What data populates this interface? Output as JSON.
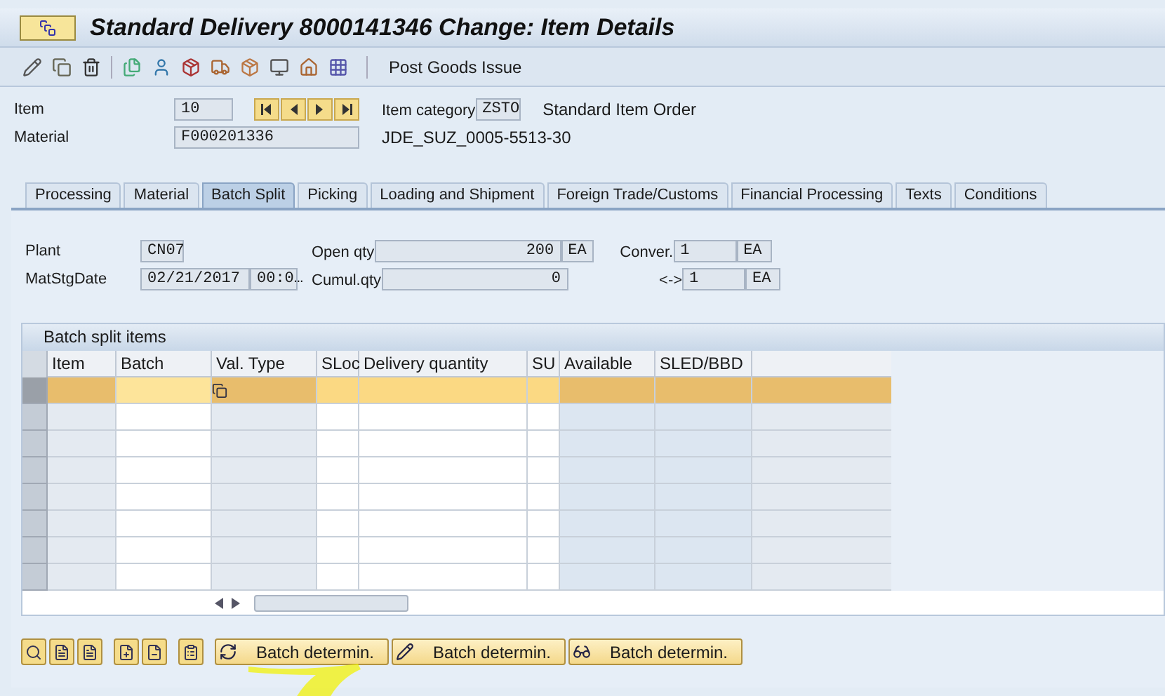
{
  "window": {
    "title": "Standard Delivery 8000141346 Change: Item Details"
  },
  "toolbar": {
    "action": "Post Goods Issue"
  },
  "header": {
    "item_label": "Item",
    "item": "10",
    "category_label": "Item category",
    "category": "ZSTO",
    "category_text": "Standard Item Order",
    "material_label": "Material",
    "material": "F000201336",
    "material_text": "JDE_SUZ_0005-5513-30"
  },
  "tabs": [
    {
      "label": "Processing",
      "selected": false
    },
    {
      "label": "Material",
      "selected": false
    },
    {
      "label": "Batch Split",
      "selected": true
    },
    {
      "label": "Picking",
      "selected": false
    },
    {
      "label": "Loading and Shipment",
      "selected": false
    },
    {
      "label": "Foreign Trade/Customs",
      "selected": false
    },
    {
      "label": "Financial Processing",
      "selected": false
    },
    {
      "label": "Texts",
      "selected": false
    },
    {
      "label": "Conditions",
      "selected": false
    }
  ],
  "fields": {
    "plant_label": "Plant",
    "plant": "CN07",
    "date_label": "MatStgDate",
    "date": "02/21/2017",
    "time": "00:0…",
    "open_label": "Open qty",
    "open": "200",
    "open_unit": "EA",
    "cumul_label": "Cumul.qty",
    "cumul": "0",
    "conv_label": "Conver.",
    "conv": "1",
    "conv_unit": "EA",
    "arrow_label": "<->",
    "conv2": "1",
    "conv2_unit": "EA"
  },
  "table": {
    "title": "Batch split items",
    "columns": [
      {
        "label": "Item",
        "editable": false
      },
      {
        "label": "Batch",
        "editable": true
      },
      {
        "label": "Val. Type",
        "editable": false
      },
      {
        "label": "SLoc",
        "editable": true
      },
      {
        "label": "Delivery quantity",
        "editable": true
      },
      {
        "label": "SU",
        "editable": true
      },
      {
        "label": "Available",
        "editable": false
      },
      {
        "label": "SLED/BBD",
        "editable": false
      }
    ],
    "rows": [
      {
        "selected": true
      },
      {
        "selected": false
      },
      {
        "selected": false
      },
      {
        "selected": false
      },
      {
        "selected": false
      },
      {
        "selected": false
      },
      {
        "selected": false
      },
      {
        "selected": false
      }
    ]
  },
  "buttons": [
    "Batch determin.",
    "Batch determin.",
    "Batch determin."
  ]
}
